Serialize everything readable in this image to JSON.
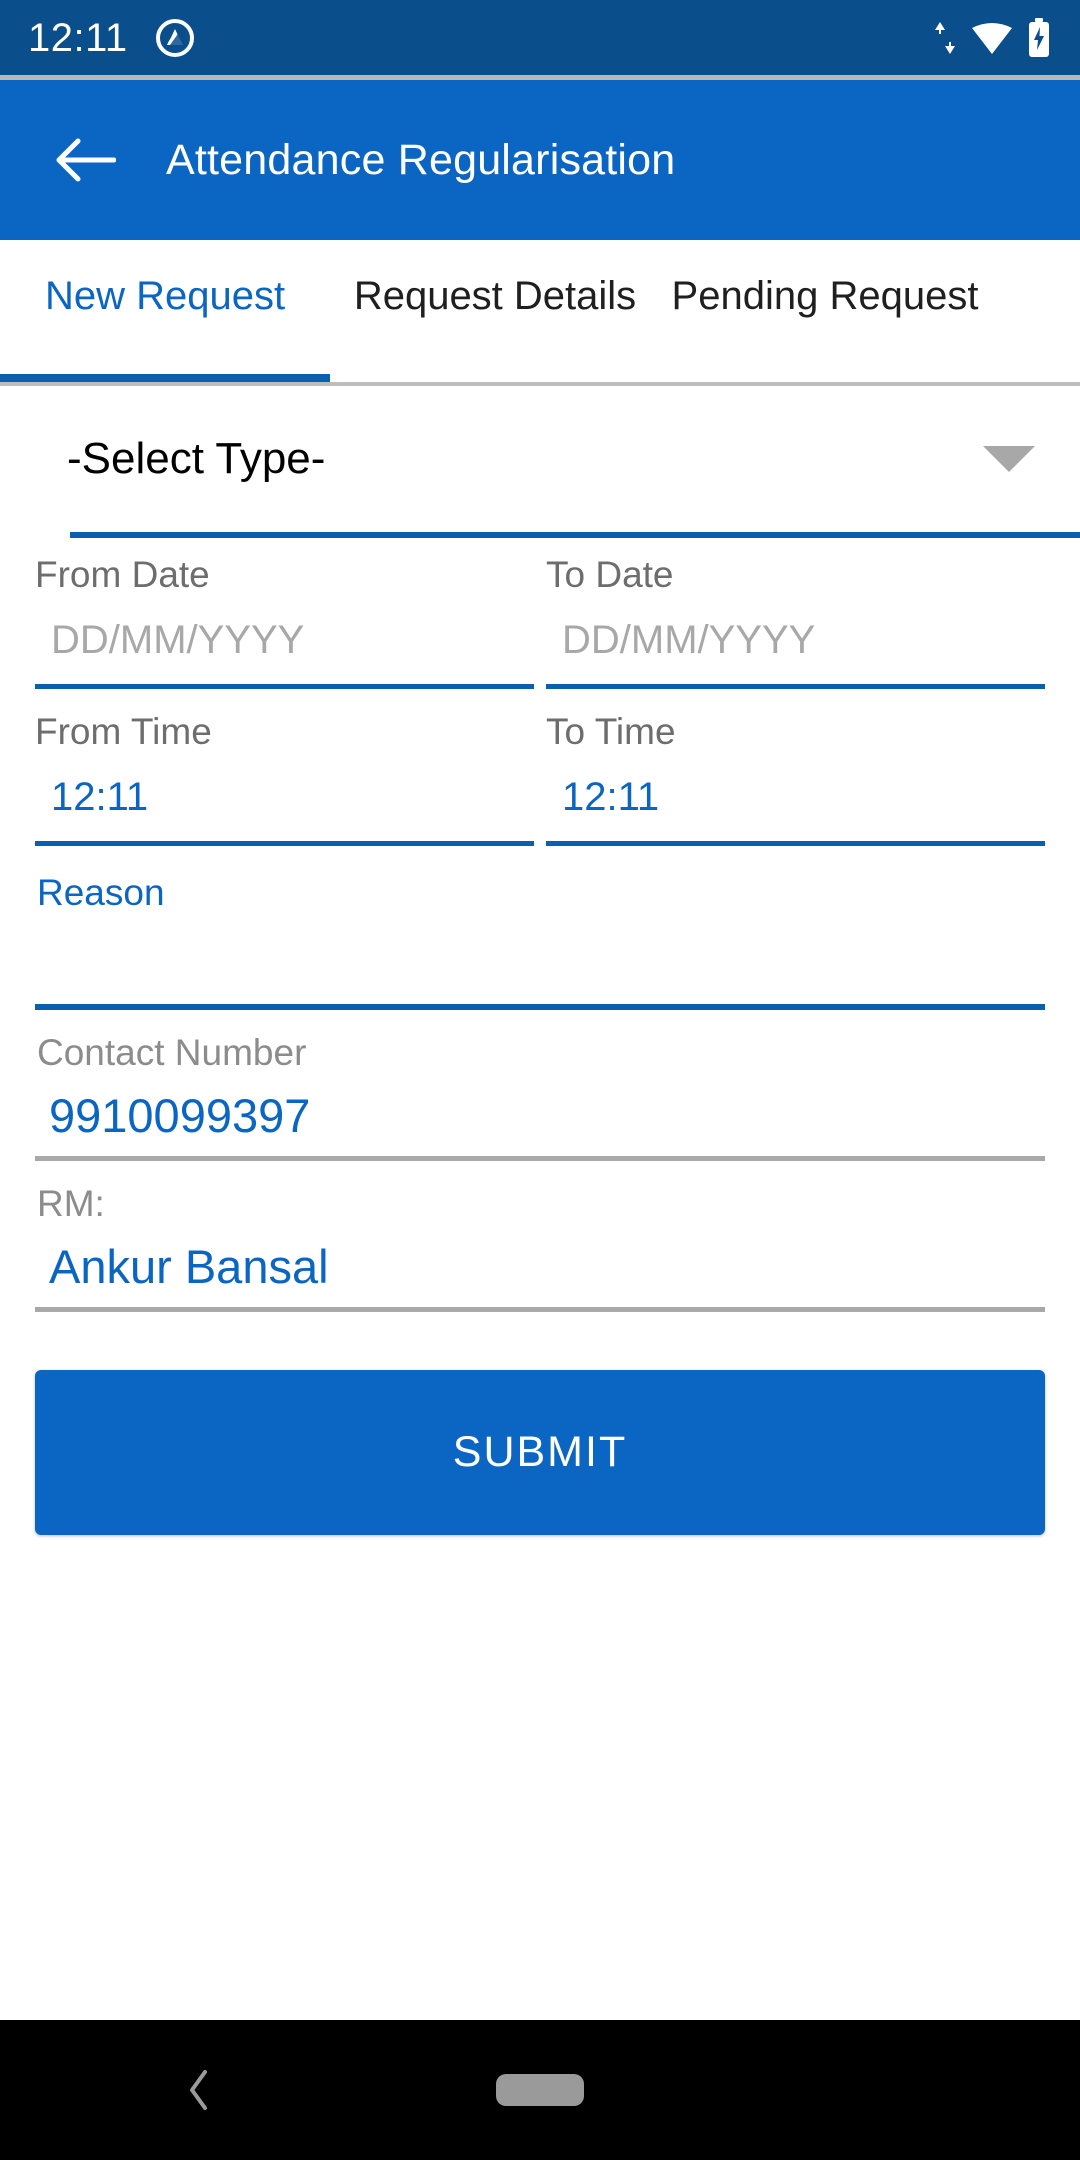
{
  "status_bar": {
    "time": "12:11",
    "background_color": "#0A4E8C",
    "icons": {
      "notification": "app-notification-icon",
      "data_transfer": "data-transfer-icon",
      "wifi": "wifi-icon",
      "battery": "battery-charging-icon"
    }
  },
  "app_bar": {
    "title": "Attendance Regularisation",
    "back_icon": "back-arrow-icon",
    "background_color": "#0B66C3"
  },
  "tabs": {
    "active_index": 0,
    "accent_color": "#0B5FAF",
    "items": [
      {
        "label": "New Request"
      },
      {
        "label": "Request Details"
      },
      {
        "label": "Pending Request"
      }
    ]
  },
  "form": {
    "type_select": {
      "value": "-Select Type-",
      "caret_icon": "chevron-down-icon"
    },
    "from_date": {
      "label": "From Date",
      "value": "",
      "placeholder": "DD/MM/YYYY"
    },
    "to_date": {
      "label": "To Date",
      "value": "",
      "placeholder": "DD/MM/YYYY"
    },
    "from_time": {
      "label": "From Time",
      "value": "12:11"
    },
    "to_time": {
      "label": "To Time",
      "value": "12:11"
    },
    "reason": {
      "label": "Reason",
      "value": ""
    },
    "contact_number": {
      "label": "Contact Number",
      "value": "9910099397"
    },
    "rm": {
      "label": "RM:",
      "value": "Ankur Bansal"
    },
    "submit_label": "SUBMIT",
    "submit_color": "#0B66C3"
  },
  "nav_bar": {
    "back_icon": "nav-back-icon",
    "home_pill": "nav-home-pill",
    "background_color": "#000000"
  }
}
